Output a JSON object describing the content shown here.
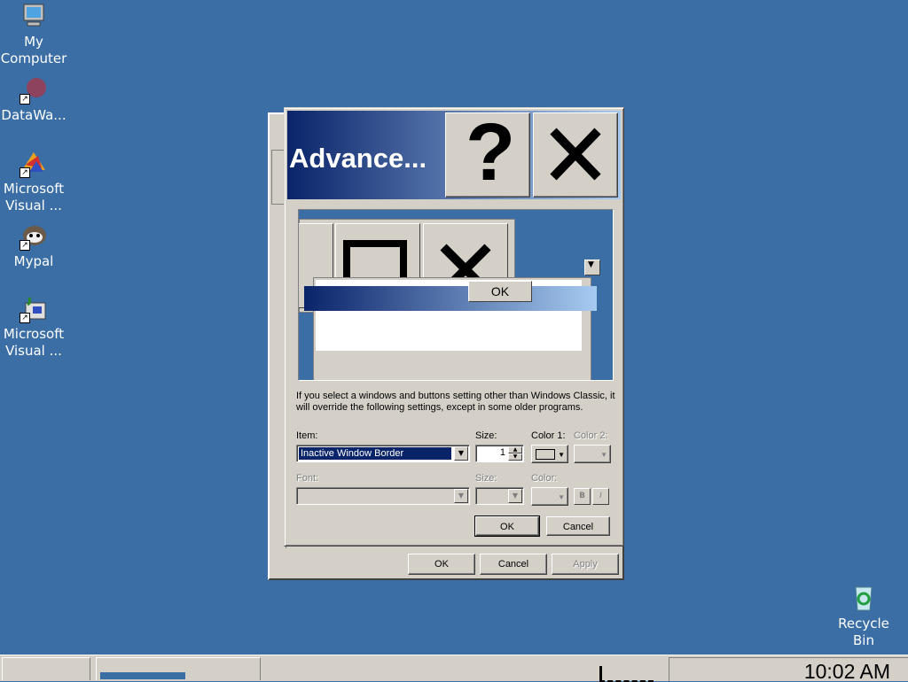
{
  "desktop": {
    "icons": [
      {
        "label": "My Computer",
        "icon": "my-computer-icon"
      },
      {
        "label": "DataWa...",
        "icon": "datawarehouse-icon"
      },
      {
        "label": "Microsoft Visual ...",
        "icon": "visual-studio-icon"
      },
      {
        "label": "Mypal",
        "icon": "mypal-icon"
      },
      {
        "label": "Microsoft Visual ...",
        "icon": "visual-studio-setup-icon"
      },
      {
        "label": "Recycle Bin",
        "icon": "recycle-bin-icon"
      }
    ]
  },
  "back_dialog": {
    "buttons": {
      "ok": "OK",
      "cancel": "Cancel",
      "apply": "Apply"
    }
  },
  "dialog": {
    "title": "Advance...",
    "help_glyph": "?",
    "preview": {
      "ok_label": "OK"
    },
    "description": "If you select a windows and buttons setting other than Windows Classic, it will override the following settings, except in some older programs.",
    "item_label": "Item:",
    "item_value": "Inactive Window Border",
    "size_label": "Size:",
    "size_value": "1",
    "color1_label": "Color 1:",
    "color2_label": "Color 2:",
    "font_label": "Font:",
    "font_size_label": "Size:",
    "font_color_label": "Color:",
    "bold_label": "B",
    "italic_label": "I",
    "ok_label": "OK",
    "cancel_label": "Cancel"
  },
  "taskbar": {
    "clock": "10:02 AM"
  },
  "colors": {
    "desktop": "#3a6ea5",
    "title_start": "#0a246a",
    "title_end": "#a6caf0",
    "face": "#d4d0c8"
  }
}
